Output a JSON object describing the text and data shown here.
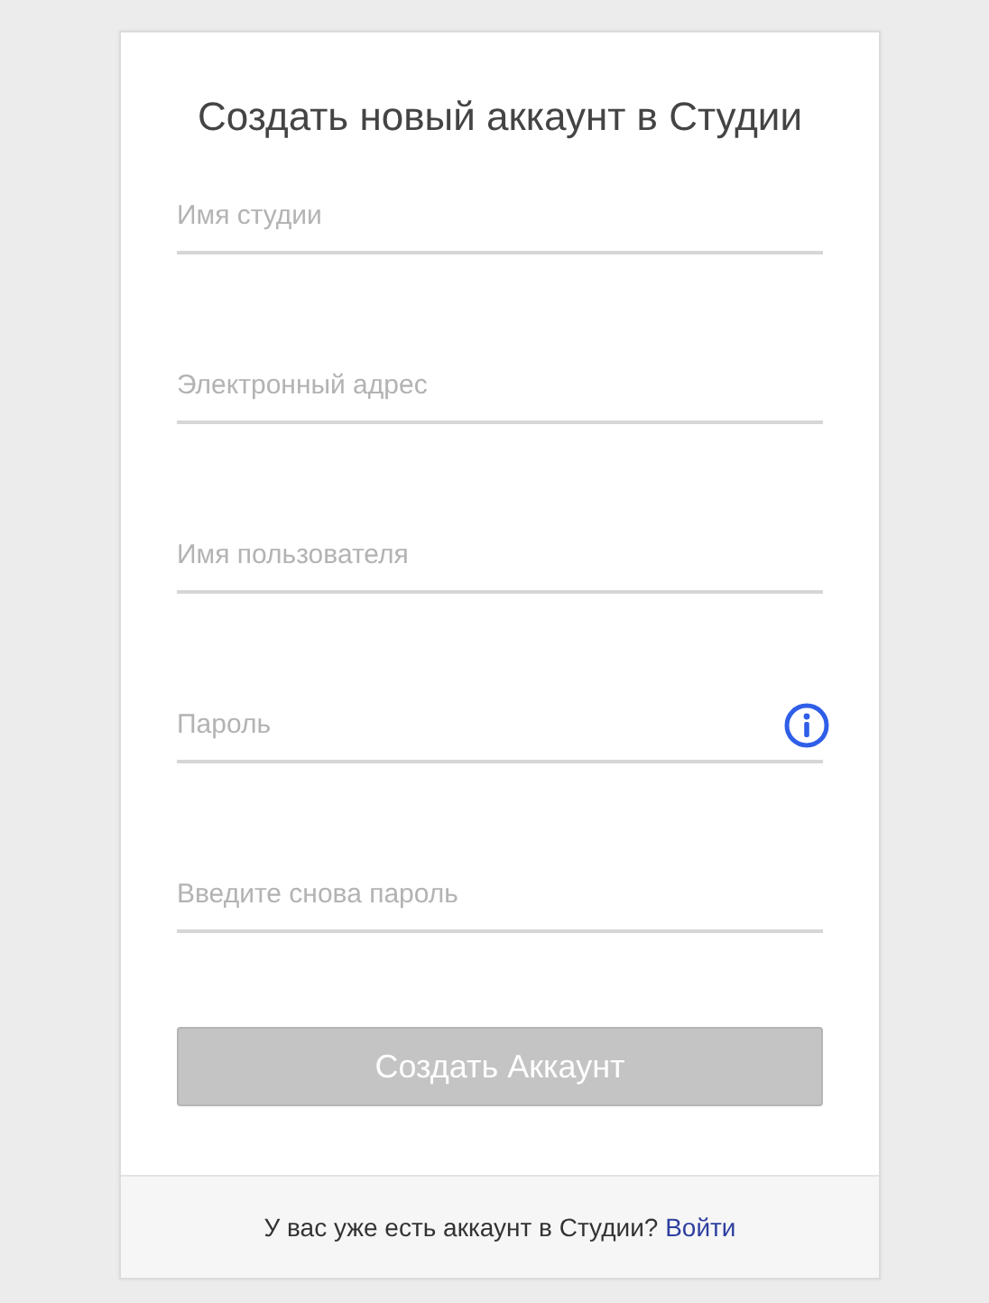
{
  "title": "Создать новый аккаунт в Студии",
  "fields": [
    {
      "placeholder": "Имя студии",
      "info": false
    },
    {
      "placeholder": "Электронный адрес",
      "info": false
    },
    {
      "placeholder": "Имя пользователя",
      "info": false
    },
    {
      "placeholder": "Пароль",
      "info": true
    },
    {
      "placeholder": "Введите снова пароль",
      "info": false
    }
  ],
  "submit_button": {
    "label": "Создать Аккаунт",
    "disabled": true
  },
  "footer": {
    "text": "У вас уже есть аккаунт в Студии?",
    "link": "Войти"
  }
}
